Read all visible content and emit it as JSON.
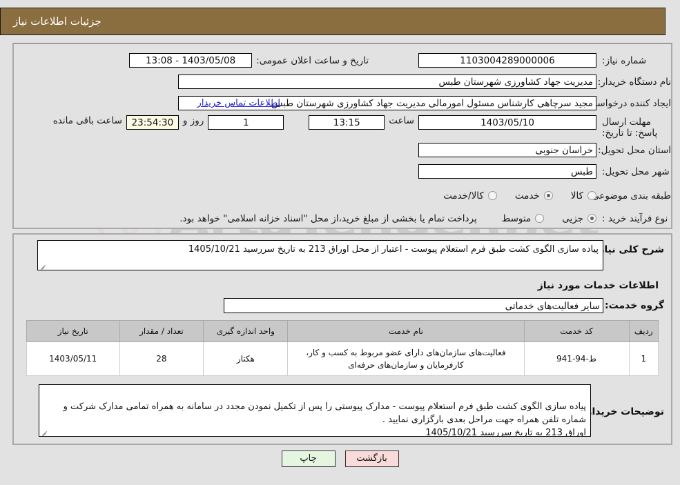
{
  "header": {
    "title": "جزئیات اطلاعات نیاز"
  },
  "form": {
    "need_number_label": "شماره نیاز:",
    "need_number_value": "1103004289000006",
    "announce_datetime_label": "تاریخ و ساعت اعلان عمومی:",
    "announce_datetime_value": "1403/05/08 - 13:08",
    "buyer_org_label": "نام دستگاه خریدار:",
    "buyer_org_value": "مدیریت جهاد کشاورزی شهرستان طبس",
    "creator_label": "ایجاد کننده درخواست:",
    "creator_value": "مجید سرچاهی کارشناس مسئول امورمالی مدیریت جهاد کشاورزی شهرستان طبس",
    "contact_link": "اطلاعات تماس خریدار",
    "deadline_label": "مهلت ارسال پاسخ: تا تاریخ:",
    "deadline_date": "1403/05/10",
    "hour_label": "ساعت",
    "deadline_time": "13:15",
    "days_value": "1",
    "days_label": "روز و",
    "countdown_value": "23:54:30",
    "countdown_label": "ساعت باقی مانده",
    "province_label": "استان محل تحویل:",
    "province_value": "خراسان جنوبی",
    "city_label": "شهر محل تحویل:",
    "city_value": "طبس",
    "category_label": "طبقه بندی موضوعی:",
    "category_options": [
      {
        "label": "کالا",
        "selected": false
      },
      {
        "label": "خدمت",
        "selected": true
      },
      {
        "label": "کالا/خدمت",
        "selected": false
      }
    ],
    "process_label": "نوع فرآیند خرید :",
    "process_options": [
      {
        "label": "جزیی",
        "selected": true
      },
      {
        "label": "متوسط",
        "selected": false
      }
    ],
    "payment_note": "پرداخت تمام یا بخشی از مبلغ خرید،از محل \"اسناد خزانه اسلامی\" خواهد بود."
  },
  "description": {
    "label": "شرح کلی نیاز:",
    "value": "پیاده سازی الگوی کشت طبق فرم استعلام پیوست - اعتبار از محل اوراق 213 به تاریخ سررسید 1405/10/21"
  },
  "services": {
    "section_title": "اطلاعات خدمات مورد نیاز",
    "group_label": "گروه خدمت:",
    "group_value": "سایر فعالیت‌های خدماتی",
    "columns": [
      "ردیف",
      "کد خدمت",
      "نام خدمت",
      "واحد اندازه گیری",
      "تعداد / مقدار",
      "تاریخ نیاز"
    ],
    "rows": [
      {
        "index": "1",
        "code": "ط-94-941",
        "name": "فعالیت‌های سازمان‌های دارای عضو مربوط به کسب و کار، کارفرمایان و سازمان‌های حرفه‌ای",
        "unit": "هکتار",
        "quantity": "28",
        "need_date": "1403/05/11"
      }
    ]
  },
  "buyer_notes": {
    "label": "توضیحات خریدار:",
    "value": "پیاده سازی الگوی کشت طبق فرم استعلام پیوست - مدارک پیوستی را پس از تکمیل نمودن مجدد در سامانه به همراه تمامی مدارک شرکت و شماره تلفن همراه جهت مراحل بعدی بارگزاری نمایید .\nاوراق 213 به تاریخ سررسید 1405/10/21"
  },
  "footer": {
    "back_label": "بازگشت",
    "print_label": "چاپ"
  },
  "watermark": {
    "text": "ArtaTender.net"
  },
  "colors": {
    "header_bg": "#8b6e3f",
    "page_bg": "#e2e2e2",
    "link": "#2222cc",
    "back_btn": "#fadbdb",
    "print_btn": "#e4f6e0",
    "countdown_bg": "#fdfbe4"
  }
}
